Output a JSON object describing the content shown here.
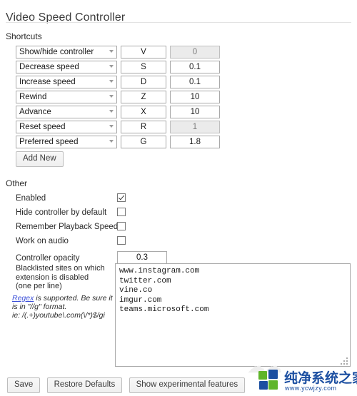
{
  "header": {
    "title": "Video Speed Controller"
  },
  "shortcuts": {
    "heading": "Shortcuts",
    "add_new_label": "Add New",
    "rows": [
      {
        "action": "Show/hide controller",
        "key": "V",
        "value": "0",
        "value_disabled": true
      },
      {
        "action": "Decrease speed",
        "key": "S",
        "value": "0.1",
        "value_disabled": false
      },
      {
        "action": "Increase speed",
        "key": "D",
        "value": "0.1",
        "value_disabled": false
      },
      {
        "action": "Rewind",
        "key": "Z",
        "value": "10",
        "value_disabled": false
      },
      {
        "action": "Advance",
        "key": "X",
        "value": "10",
        "value_disabled": false
      },
      {
        "action": "Reset speed",
        "key": "R",
        "value": "1",
        "value_disabled": true
      },
      {
        "action": "Preferred speed",
        "key": "G",
        "value": "1.8",
        "value_disabled": false
      }
    ],
    "action_options": [
      "Show/hide controller",
      "Decrease speed",
      "Increase speed",
      "Rewind",
      "Advance",
      "Reset speed",
      "Preferred speed"
    ]
  },
  "other": {
    "heading": "Other",
    "rows": [
      {
        "label": "Enabled",
        "type": "checkbox",
        "checked": true
      },
      {
        "label": "Hide controller by default",
        "type": "checkbox",
        "checked": false
      },
      {
        "label": "Remember Playback Speed",
        "type": "checkbox",
        "checked": false
      },
      {
        "label": "Work on audio",
        "type": "checkbox",
        "checked": false
      }
    ],
    "opacity": {
      "label": "Controller opacity",
      "value": "0.3"
    }
  },
  "blacklist": {
    "label_line1": "Blacklisted sites on which",
    "label_line2": "extension is disabled",
    "label_line3": "(one per line)",
    "regex_link": "Regex",
    "regex_note_1": " is supported. Be sure it is in \"//g\" format.",
    "regex_note_2": "ie: /(.+)youtube\\.com(\\/*)$/gi",
    "value": "www.instagram.com\ntwitter.com\nvine.co\nimgur.com\nteams.microsoft.com"
  },
  "footer": {
    "save_label": "Save",
    "restore_label": "Restore Defaults",
    "experimental_label": "Show experimental features"
  },
  "watermark": {
    "brand": "纯净系统之家",
    "url": "www.ycwjzy.com",
    "colors": {
      "blue": "#1c4fa1",
      "green": "#5fb52a"
    }
  }
}
